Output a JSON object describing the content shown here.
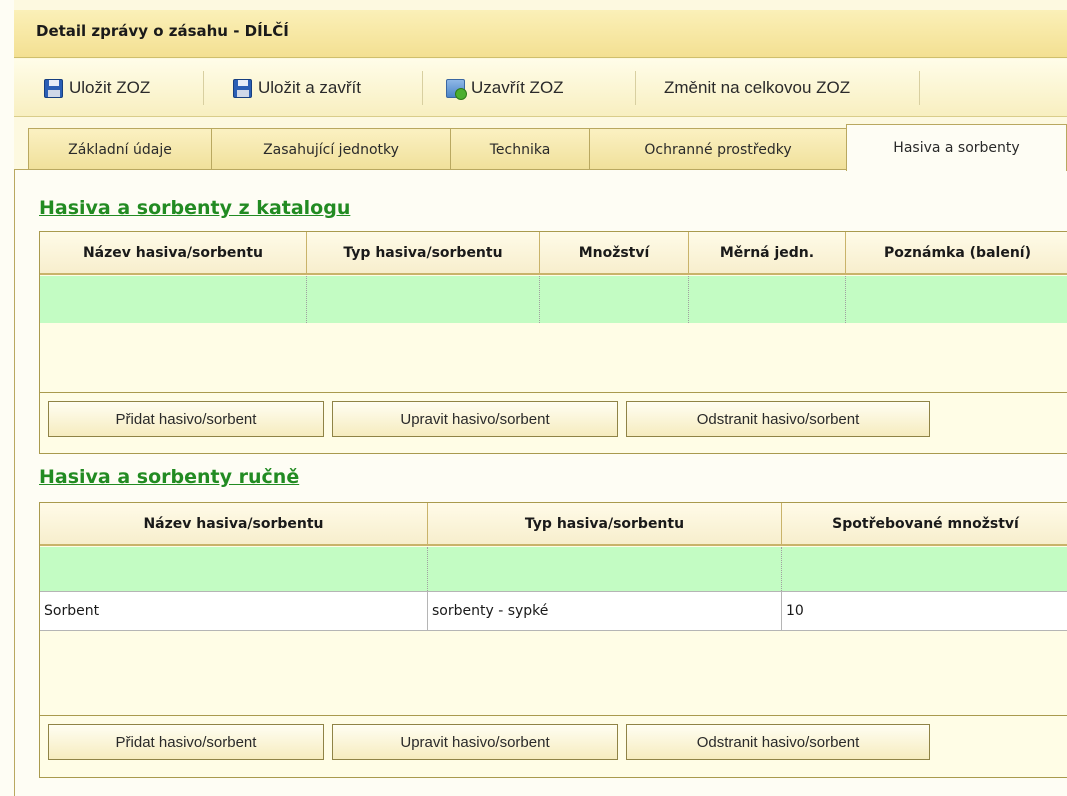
{
  "window": {
    "title": "Detail zprávy o zásahu - DÍLČÍ"
  },
  "toolbar": {
    "save_label": "Uložit ZOZ",
    "save_close_label": "Uložit a zavřít",
    "close_zoz_label": "Uzavřít ZOZ",
    "change_label": "Změnit na celkovou ZOZ"
  },
  "tabs": [
    {
      "label": "Základní údaje"
    },
    {
      "label": "Zasahující jednotky"
    },
    {
      "label": "Technika"
    },
    {
      "label": "Ochranné prostředky"
    },
    {
      "label": "Hasiva a sorbenty"
    }
  ],
  "catalog": {
    "title": "Hasiva a sorbenty z katalogu",
    "columns": [
      "Název hasiva/sorbentu",
      "Typ hasiva/sorbentu",
      "Množství",
      "Měrná jedn.",
      "Poznámka (balení)"
    ],
    "buttons": {
      "add": "Přidat hasivo/sorbent",
      "edit": "Upravit hasivo/sorbent",
      "remove": "Odstranit hasivo/sorbent"
    }
  },
  "manual": {
    "title": "Hasiva a sorbenty ručně",
    "columns": [
      "Název hasiva/sorbentu",
      "Typ hasiva/sorbentu",
      "Spotřebované množství"
    ],
    "rows": [
      {
        "name": "Sorbent",
        "type": "sorbenty - sypké",
        "amount": "10"
      }
    ],
    "buttons": {
      "add": "Přidat hasivo/sorbent",
      "edit": "Upravit hasivo/sorbent",
      "remove": "Odstranit hasivo/sorbent"
    }
  },
  "colors": {
    "section_title": "#228b22",
    "selected_row": "#c3fcc3",
    "title_bar": "#f3e092"
  }
}
